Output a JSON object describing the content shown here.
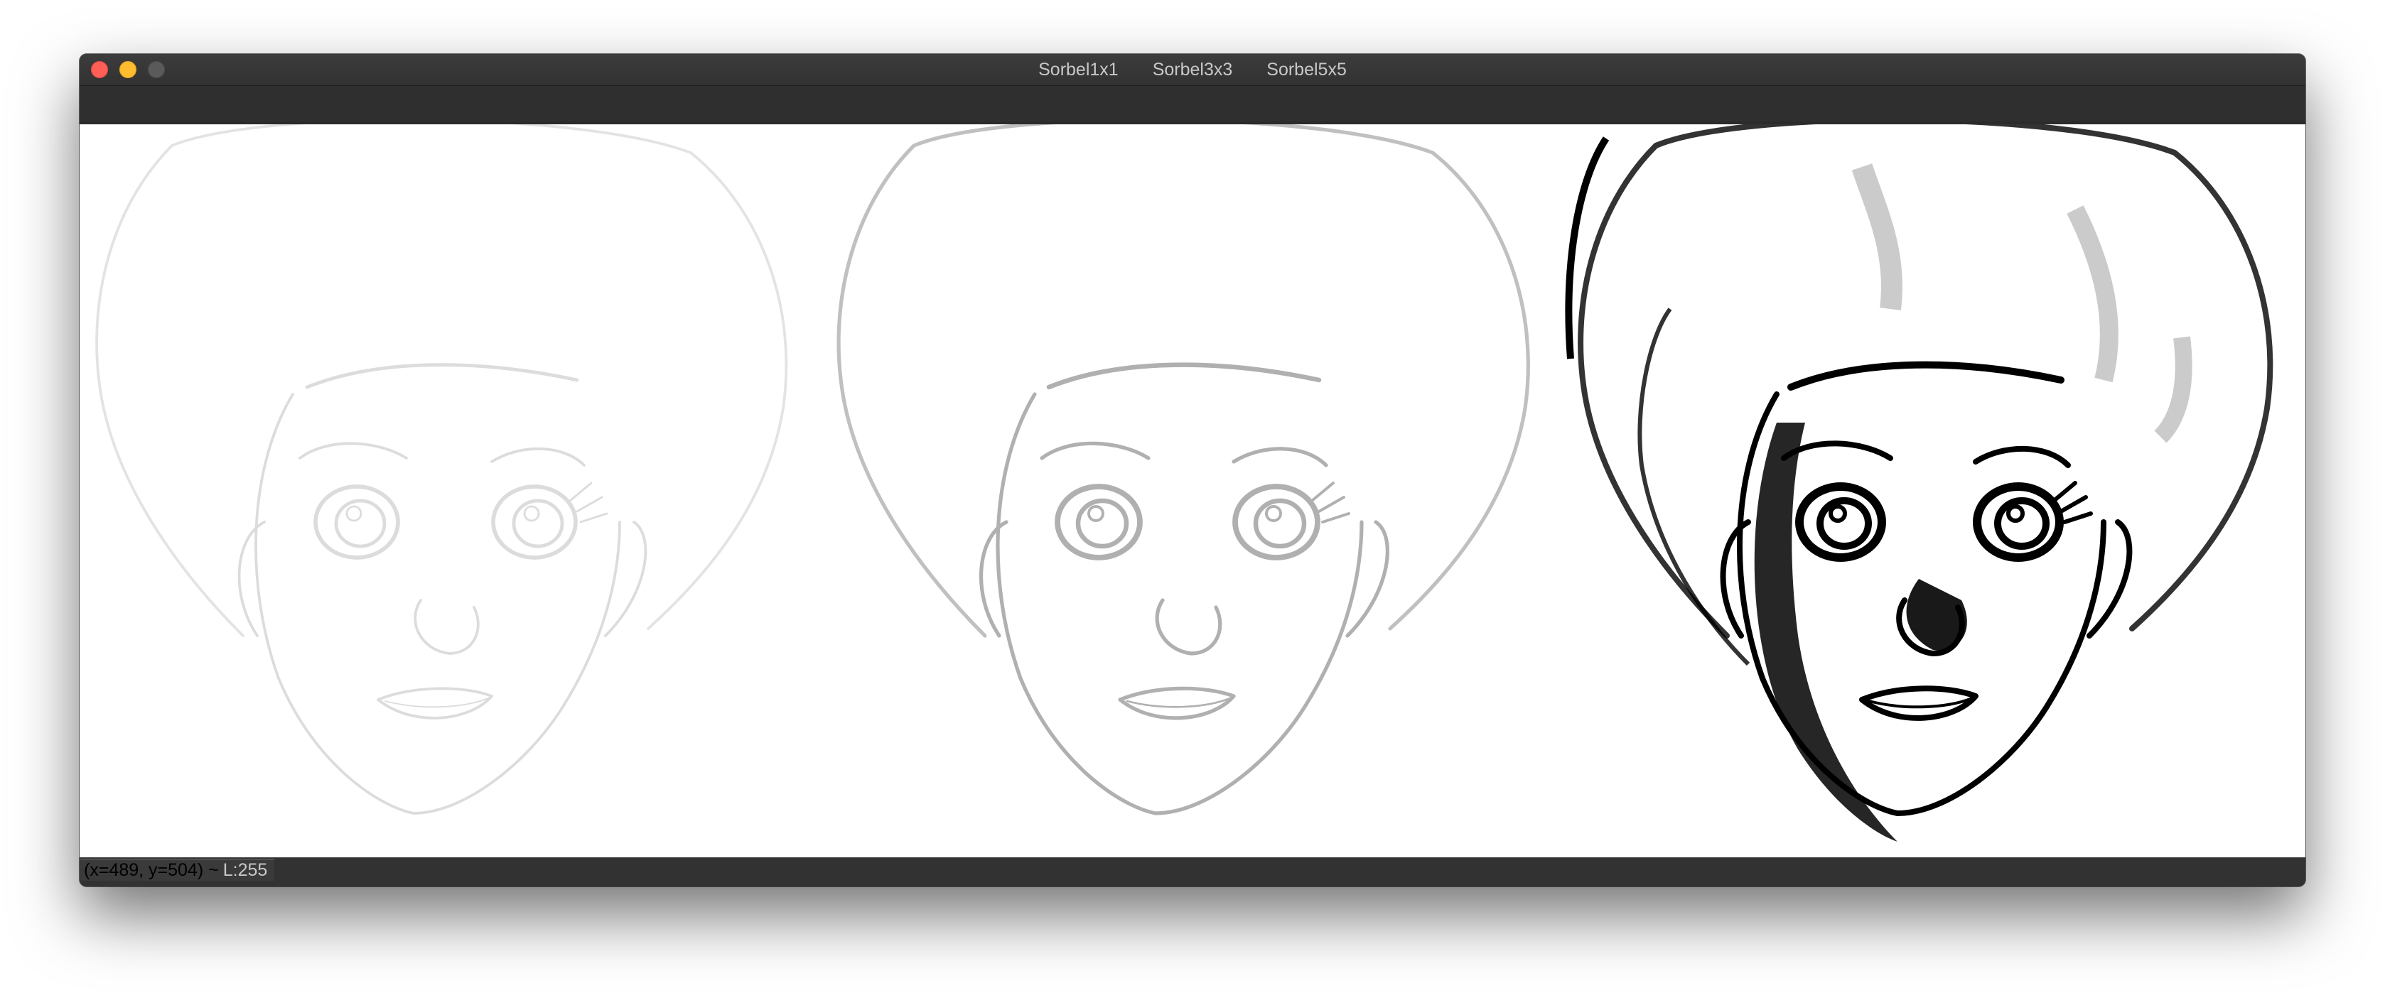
{
  "window": {
    "tabs": [
      "Sorbel1x1",
      "Sorbel3x3",
      "Sorbel5x5"
    ]
  },
  "panels": [
    {
      "name": "Sorbel1x1",
      "edge_color": "#dcdcdc",
      "edge_strength": 0.25
    },
    {
      "name": "Sorbel3x3",
      "edge_color": "#b0b0b0",
      "edge_strength": 0.5
    },
    {
      "name": "Sorbel5x5",
      "edge_color": "#000000",
      "edge_strength": 1.0
    }
  ],
  "status": {
    "coords": "(x=489, y=504) ~",
    "level": "L:255"
  },
  "colors": {
    "close": "#ff5f57",
    "minimize": "#febc2e",
    "zoom": "#5a5a5a",
    "titlebar": "#333333",
    "canvas": "#ffffff"
  }
}
